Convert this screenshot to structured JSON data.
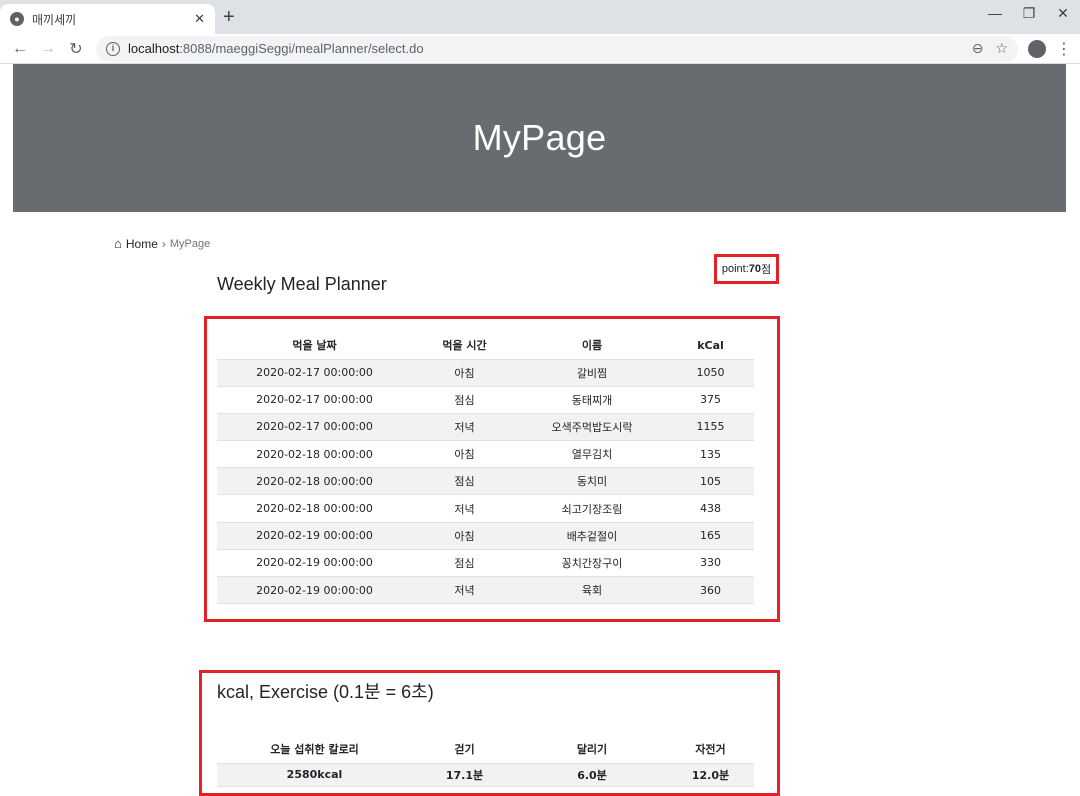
{
  "browser": {
    "tab_title": "매끼세끼",
    "url_host": "localhost",
    "url_path": ":8088/maeggiSeggi/mealPlanner/select.do"
  },
  "hero": {
    "title": "MyPage"
  },
  "breadcrumb": {
    "home": "Home",
    "separator": "›",
    "current": "MyPage"
  },
  "point": {
    "prefix": "point:",
    "value": "70",
    "suffix": "점"
  },
  "meal_planner": {
    "title": "Weekly Meal Planner",
    "headers": [
      "먹을 날짜",
      "먹을 시간",
      "이름",
      "kCal"
    ],
    "rows": [
      [
        "2020-02-17 00:00:00",
        "아침",
        "갈비찜",
        "1050"
      ],
      [
        "2020-02-17 00:00:00",
        "점심",
        "동태찌개",
        "375"
      ],
      [
        "2020-02-17 00:00:00",
        "저녁",
        "오색주먹밥도시락",
        "1155"
      ],
      [
        "2020-02-18 00:00:00",
        "아침",
        "열무김치",
        "135"
      ],
      [
        "2020-02-18 00:00:00",
        "점심",
        "동치미",
        "105"
      ],
      [
        "2020-02-18 00:00:00",
        "저녁",
        "쇠고기장조림",
        "438"
      ],
      [
        "2020-02-19 00:00:00",
        "아침",
        "배추겉절이",
        "165"
      ],
      [
        "2020-02-19 00:00:00",
        "점심",
        "꽁치간장구이",
        "330"
      ],
      [
        "2020-02-19 00:00:00",
        "저녁",
        "육회",
        "360"
      ]
    ]
  },
  "exercise": {
    "title": "kcal, Exercise (0.1분 = 6초)",
    "headers": [
      "오늘 섭취한 칼로리",
      "걷기",
      "달리기",
      "자전거"
    ],
    "values": [
      "2580kcal",
      "17.1분",
      "6.0분",
      "12.0분"
    ]
  },
  "colors": {
    "hero_bg": "#676c71",
    "highlight": "#e32227"
  }
}
